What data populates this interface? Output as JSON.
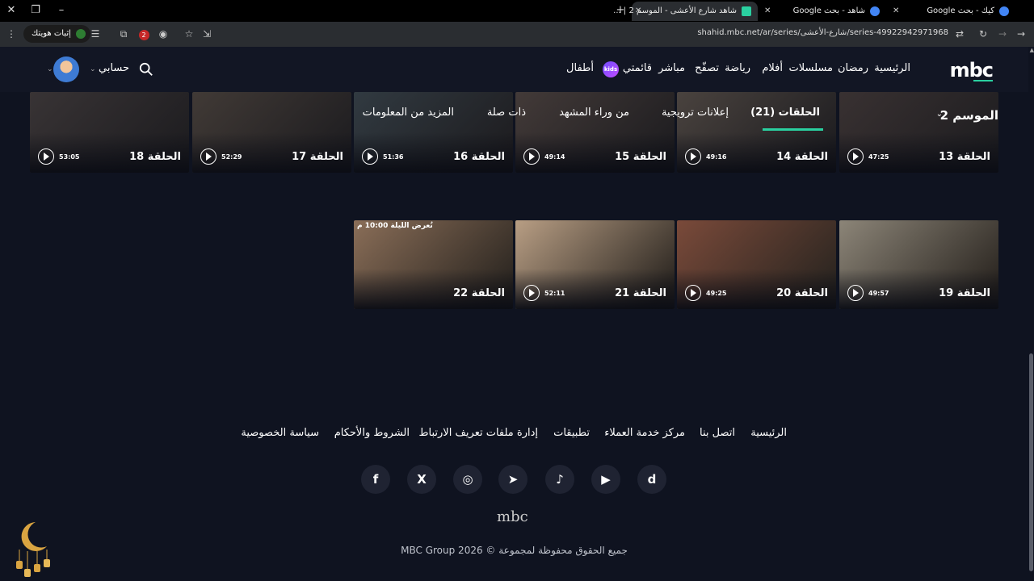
{
  "browser": {
    "tabs": [
      {
        "title": "كيك - بحث Google",
        "active": false
      },
      {
        "title": "شاهد - بحث Google",
        "active": false
      },
      {
        "title": "شاهد شارع الأعشى - الموسم 2 | ...",
        "active": true
      }
    ],
    "url": "shahid.mbc.net/ar/series/شارع-الأعشى/series-49922942971968",
    "verify_label": "إثبات هويتك",
    "profile_badge": "2"
  },
  "nav": {
    "logo": "mbc",
    "items": [
      "الرئيسية",
      "رمضان",
      "مسلسلات",
      "أفلام",
      "رياضة",
      "تصفّح",
      "مباشر",
      "قائمتي",
      "أطفال"
    ],
    "kids_badge": "kids",
    "account_label": "حسابي"
  },
  "season": {
    "label": "الموسم 2",
    "tabs": [
      "الحلقات (21)",
      "إعلانات ترويجية",
      "من وراء المشهد",
      "ذات صلة",
      "المزيد من المعلومات"
    ],
    "active_tab": 0
  },
  "episodes_top": [
    {
      "title": "الحلقة 13",
      "duration": "47:25",
      "color": "#5b4a40"
    },
    {
      "title": "الحلقة 14",
      "duration": "49:16",
      "color": "#7a6a58"
    },
    {
      "title": "الحلقة 15",
      "duration": "49:14",
      "color": "#6d5a4c"
    },
    {
      "title": "الحلقة 16",
      "duration": "51:36",
      "color": "#4d5a5c"
    },
    {
      "title": "الحلقة 17",
      "duration": "52:29",
      "color": "#6a5a48"
    },
    {
      "title": "الحلقة 18",
      "duration": "53:05",
      "color": "#5a4e46"
    }
  ],
  "episodes_bottom": [
    {
      "title": "الحلقة 19",
      "duration": "49:57",
      "color": "#8c8578",
      "airs": ""
    },
    {
      "title": "الحلقة 20",
      "duration": "49:25",
      "color": "#7a4a3a",
      "airs": ""
    },
    {
      "title": "الحلقة 21",
      "duration": "52:11",
      "color": "#b89e84",
      "airs": ""
    },
    {
      "title": "الحلقة 22",
      "duration": "",
      "color": "#8a6e58",
      "airs": "تُعرض الليلة 10:00 م"
    }
  ],
  "footer": {
    "links": [
      "الرئيسية",
      "اتصل بنا",
      "مركز خدمة العملاء",
      "تطبيقات",
      "إدارة ملفات تعريف الارتباط",
      "الشروط والأحكام",
      "سياسة الخصوصية"
    ],
    "social": [
      "d",
      "▶",
      "♪",
      "➤",
      "◎",
      "X",
      "f"
    ],
    "logo": "mbc",
    "copyright": "جميع الحقوق محفوظة لمجموعة © MBC Group 2026"
  },
  "colors": {
    "accent": "#2ad0a0",
    "background": "#0f1320",
    "nav": "#121624"
  }
}
